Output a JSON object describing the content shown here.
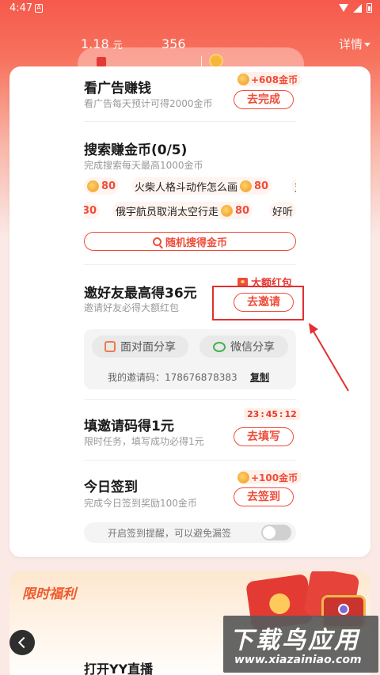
{
  "status_bar": {
    "time": "4:47"
  },
  "header": {
    "balance_value": "1.18",
    "balance_unit": "元",
    "coins_value": "356",
    "details_label": "详情"
  },
  "tasks": {
    "ad": {
      "title": "看广告赚钱",
      "desc": "看广告每天预计可得2000金币",
      "reward": "+608金币",
      "button": "去完成"
    },
    "search": {
      "title": "搜索赚金币(0/5)",
      "desc": "完成搜索每天最高1000金币",
      "row1": [
        {
          "text": "",
          "value": "80"
        },
        {
          "text": "火柴人格斗动作怎么画",
          "value": "80"
        },
        {
          "text": "支",
          "value": ""
        }
      ],
      "row2": [
        {
          "text": "",
          "value": "30"
        },
        {
          "text": "俄宇航员取消太空行走",
          "value": "80"
        },
        {
          "text": "好听",
          "value": ""
        }
      ],
      "random_button": "随机搜得金币"
    },
    "invite": {
      "badge": "大额红包",
      "title": "邀好友最高得36元",
      "desc": "邀请好友必得大额红包",
      "button": "去邀请",
      "share_face": "面对面分享",
      "share_wechat": "微信分享",
      "code_label": "我的邀请码：178676878383",
      "copy": "复制"
    },
    "fill_code": {
      "timer": [
        "23",
        "45",
        "12"
      ],
      "title": "填邀请码得1元",
      "desc": "限时任务，填写成功必得1元",
      "button": "去填写"
    },
    "checkin": {
      "title": "今日签到",
      "desc": "完成今日签到奖励100金币",
      "reward": "+100金币",
      "button": "去签到",
      "remind": "开启签到提醒，可以避免漏签",
      "remind_on": false
    }
  },
  "promo": {
    "title": "限时福利",
    "next_task": "打开YY直播"
  },
  "watermark": {
    "main": "下载鸟应用",
    "url": "www.xiazainiao.com"
  },
  "colors": {
    "accent": "#ef4c3a",
    "header_top": "#f6594b",
    "background": "#fbe9e6"
  }
}
